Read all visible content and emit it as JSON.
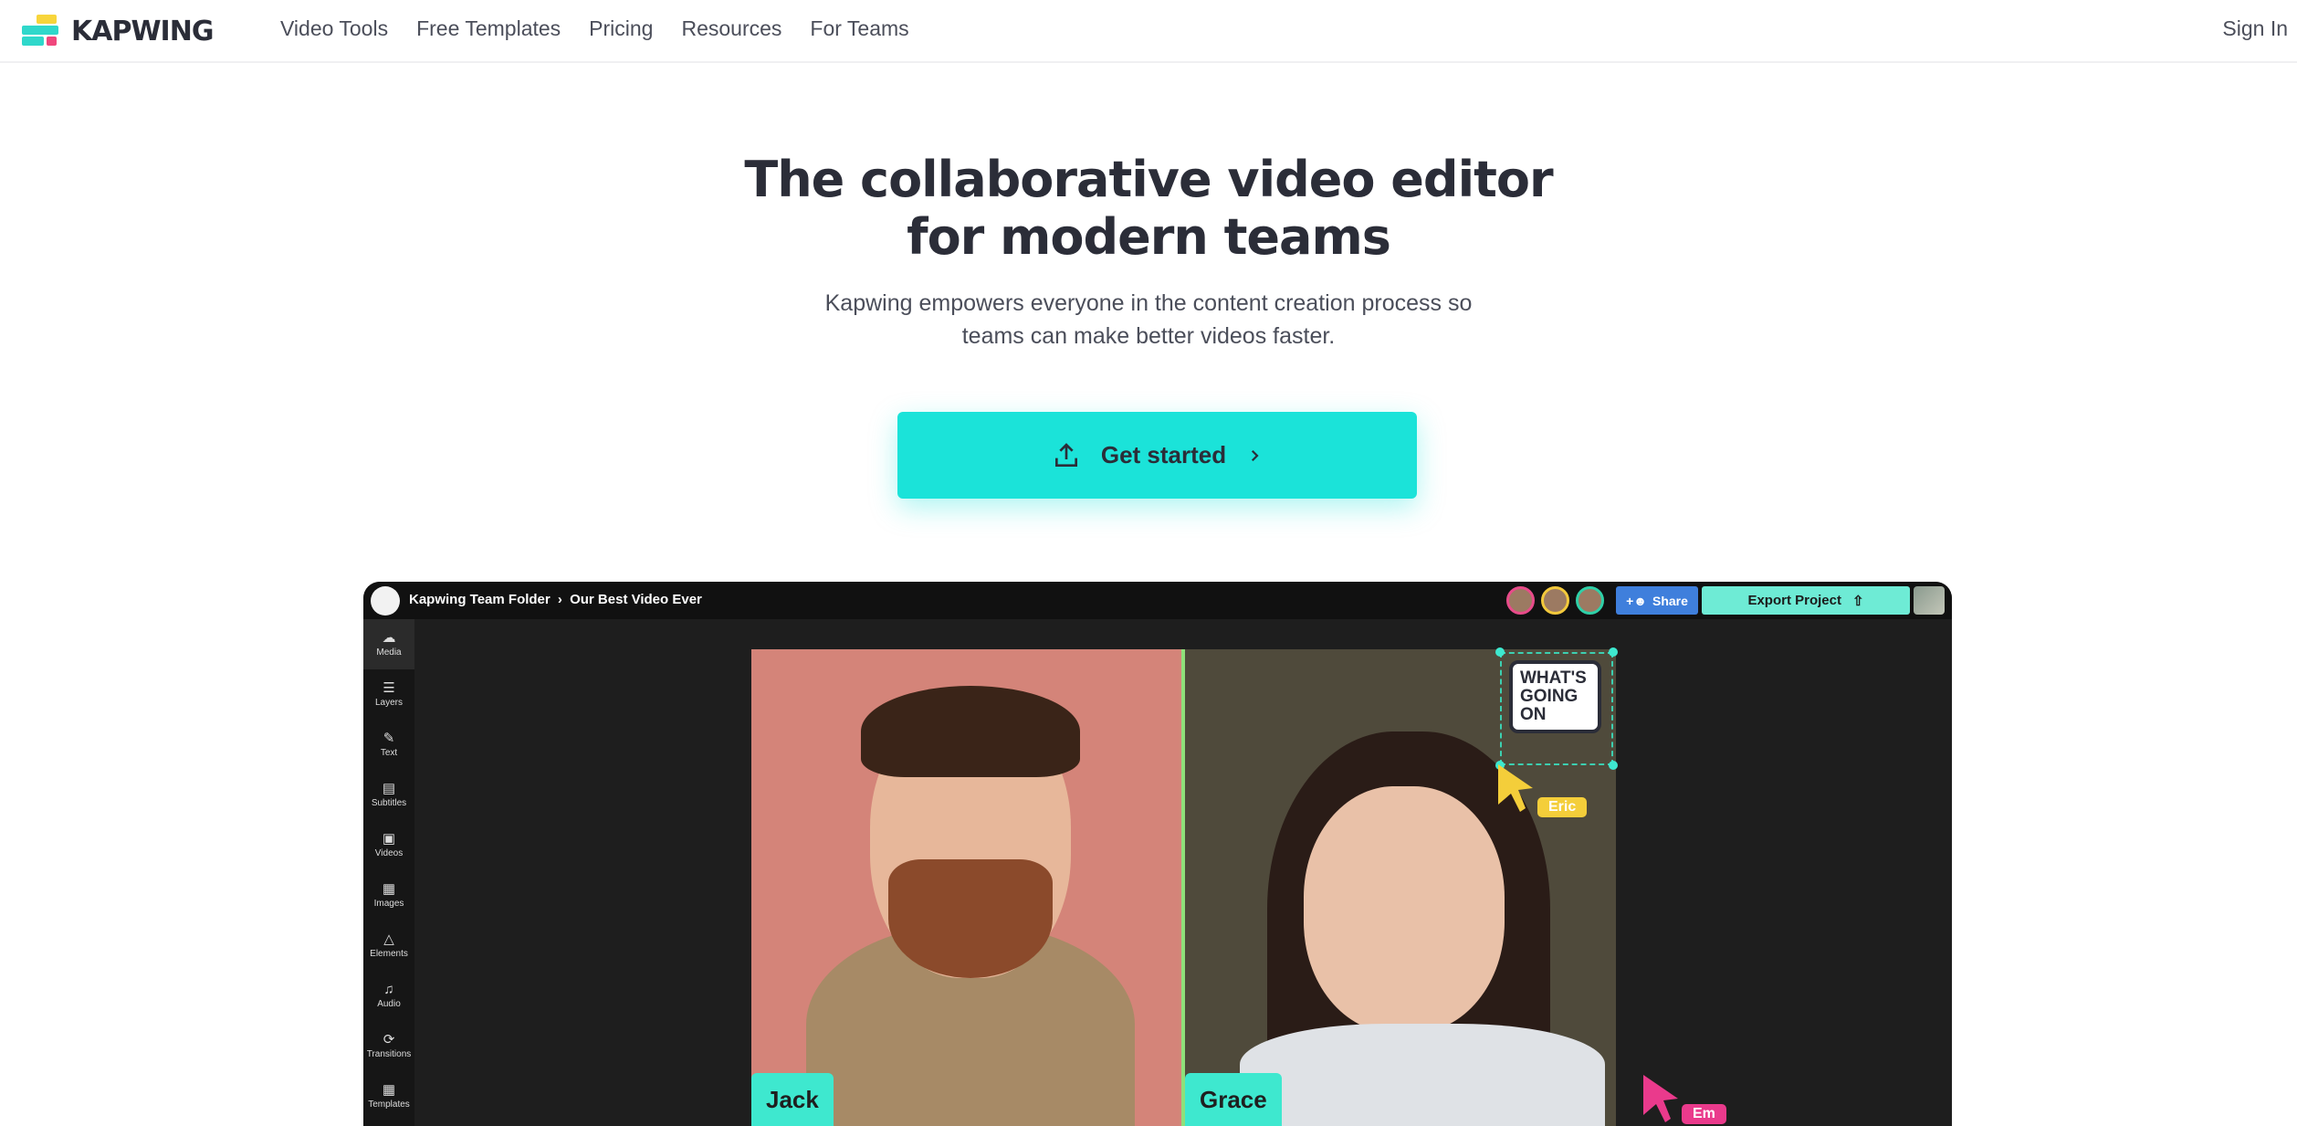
{
  "nav": {
    "brand": "KAPWING",
    "links": [
      "Video Tools",
      "Free Templates",
      "Pricing",
      "Resources",
      "For Teams"
    ],
    "sign_in": "Sign In"
  },
  "hero": {
    "title_line1": "The collaborative video editor",
    "title_line2": "for modern teams",
    "subtitle_line1": "Kapwing empowers everyone in the content creation process so",
    "subtitle_line2": "teams can make better videos faster.",
    "cta_label": "Get started",
    "cta_color": "#1be3d9"
  },
  "editor": {
    "folder": "Kapwing Team Folder",
    "separator": "›",
    "project": "Our Best Video Ever",
    "share_label": "Share",
    "export_label": "Export Project",
    "sidebar": [
      "Media",
      "Layers",
      "Text",
      "Subtitles",
      "Videos",
      "Images",
      "Elements",
      "Audio",
      "Transitions",
      "Templates"
    ],
    "speaker_left": "Jack",
    "speaker_right": "Grace",
    "bubble_text": "WHAT'S GOING ON",
    "cursor_eric": "Eric",
    "cursor_em": "Em"
  }
}
